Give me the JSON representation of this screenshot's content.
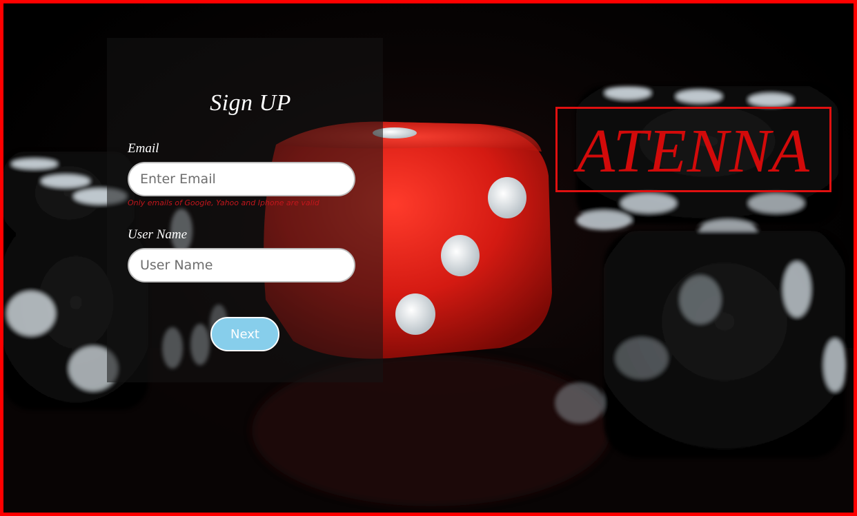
{
  "signup": {
    "title": "Sign UP",
    "email": {
      "label": "Email",
      "placeholder": "Enter Email",
      "value": "",
      "hint": "Only emails of Google, Yahoo and Iphone are valid"
    },
    "username": {
      "label": "User Name",
      "placeholder": "User Name",
      "value": ""
    },
    "next_label": "Next"
  },
  "brand": {
    "name": "ATENNA"
  },
  "colors": {
    "frame_border": "#ff0000",
    "brand": "#d20a0a",
    "next_button": "#87ceeb",
    "hint": "#c4161c",
    "die": "#d41a12"
  },
  "background": {
    "subject": "dice-photo"
  }
}
